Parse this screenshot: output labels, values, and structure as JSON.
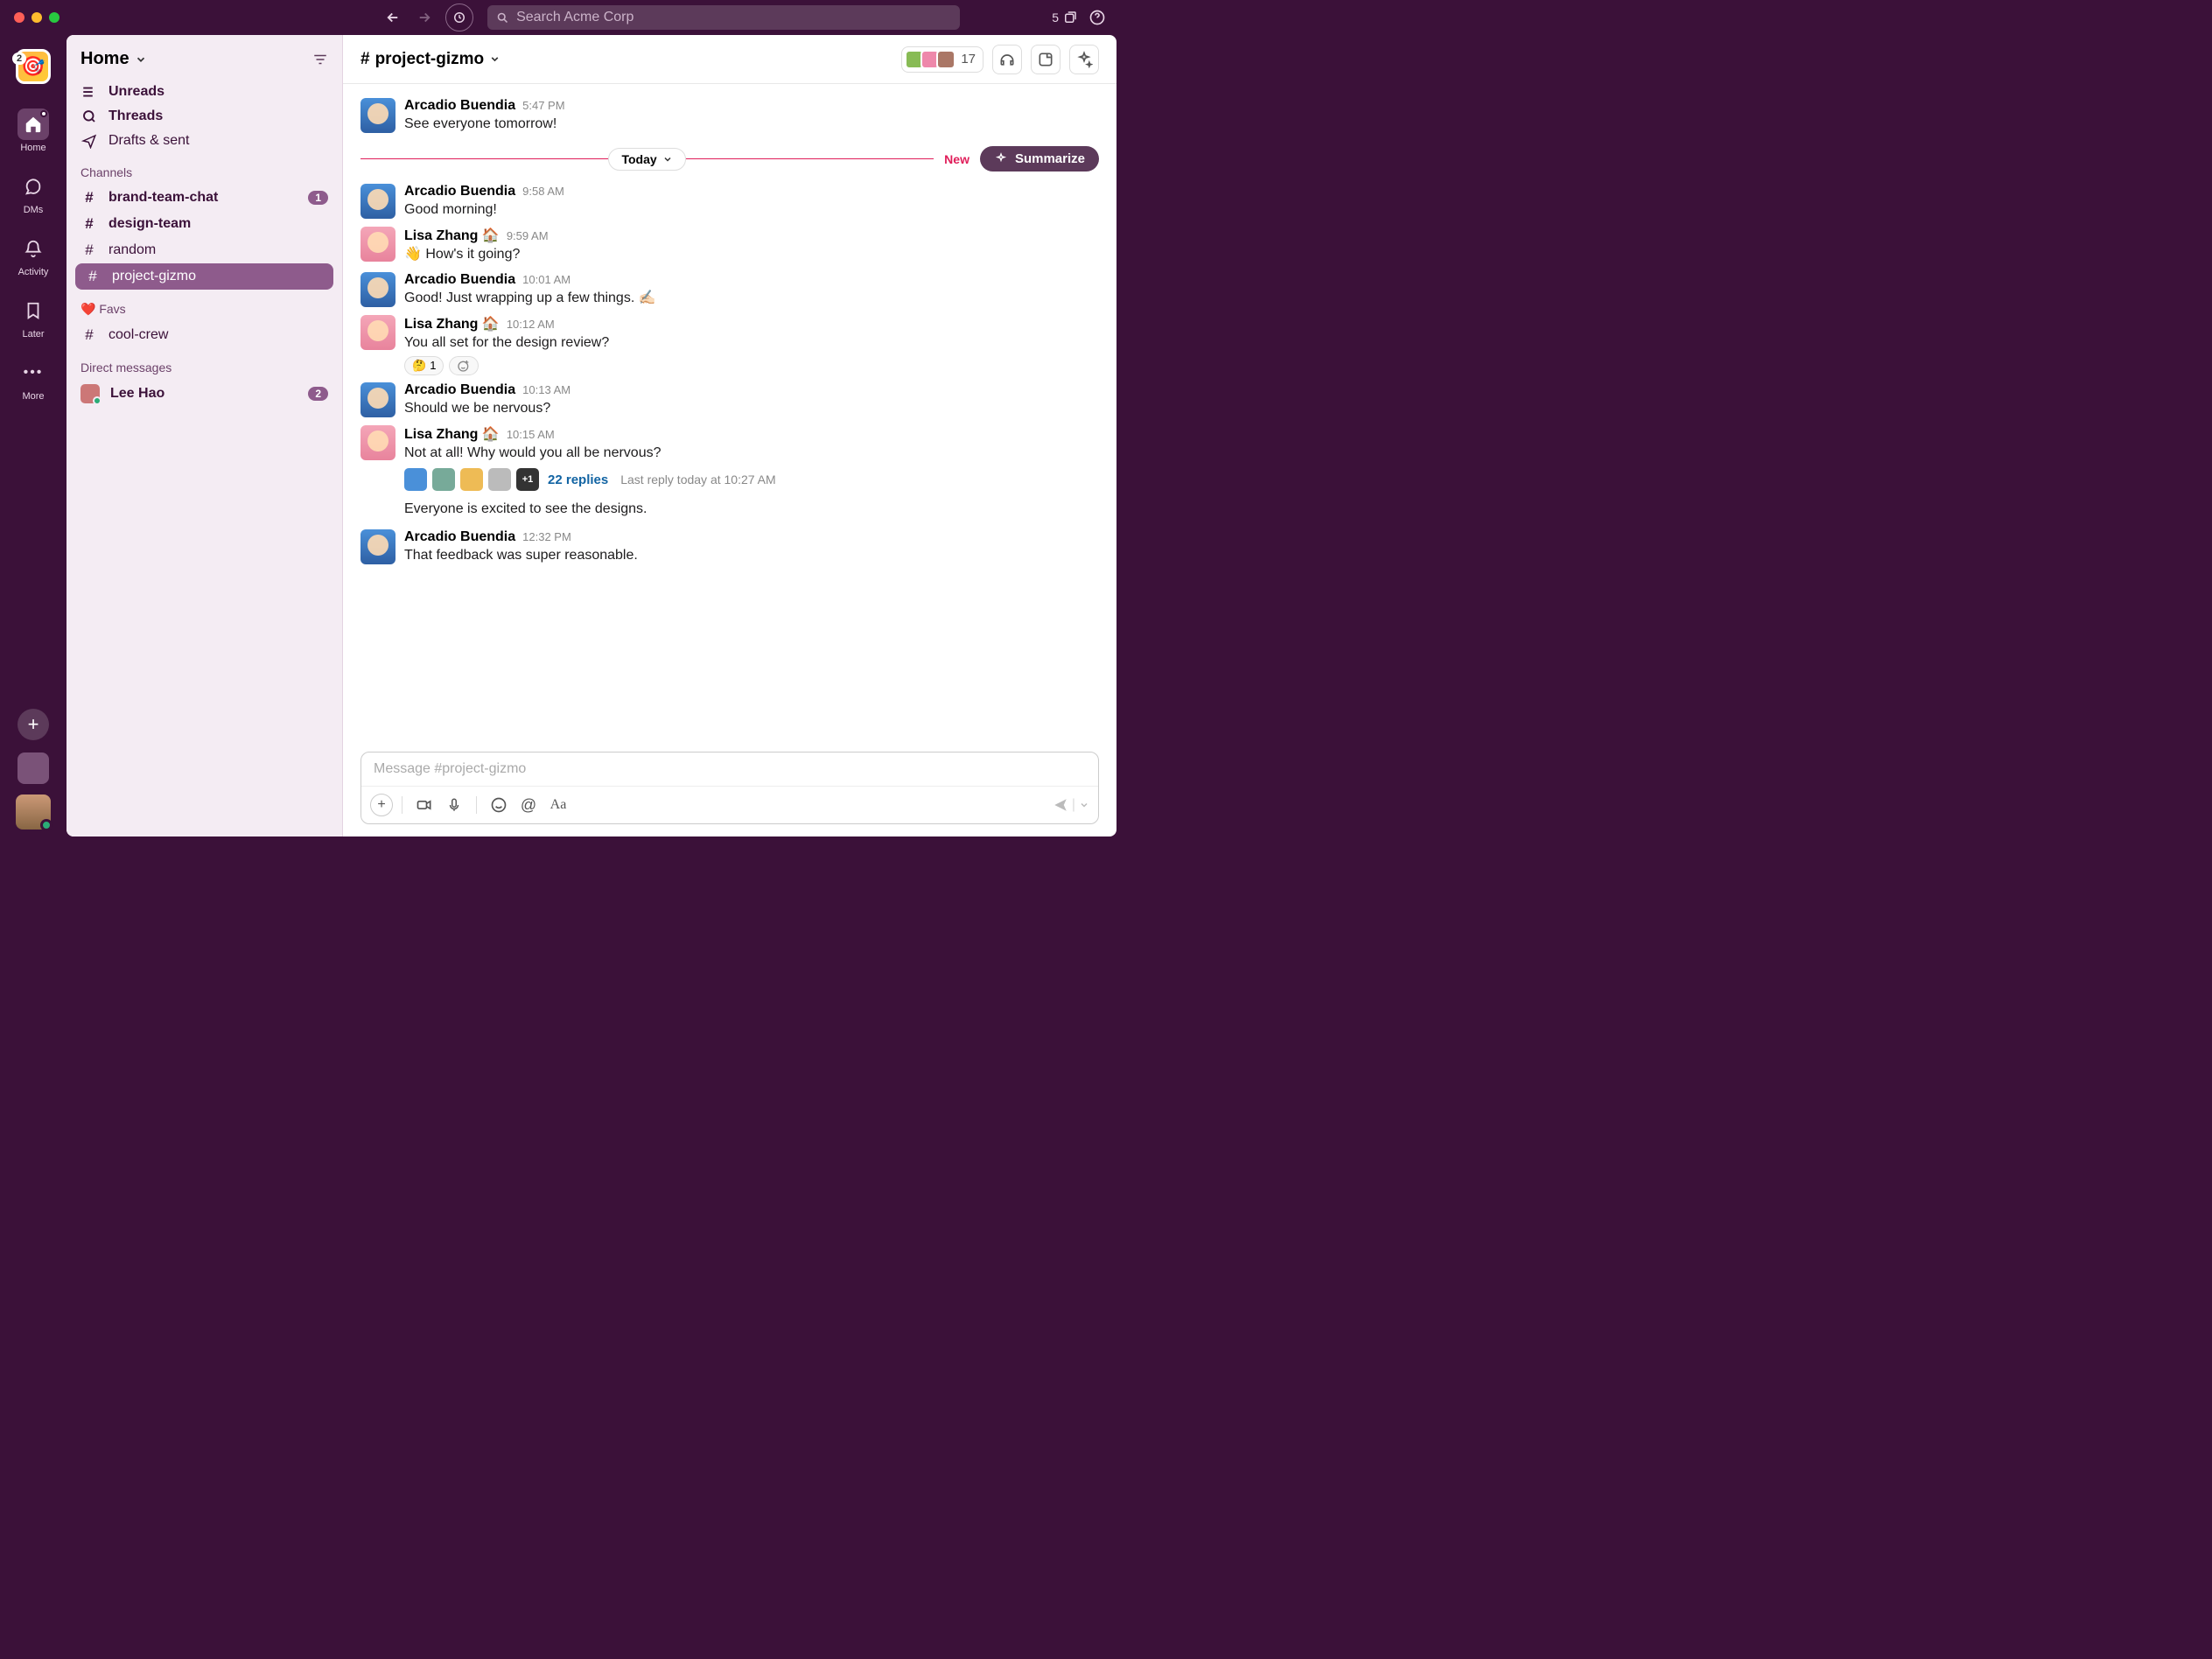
{
  "top": {
    "search_placeholder": "Search Acme Corp",
    "window_count": "5"
  },
  "workspace": {
    "badge": "2"
  },
  "rail": {
    "home": "Home",
    "dms": "DMs",
    "activity": "Activity",
    "later": "Later",
    "more": "More"
  },
  "sidebar": {
    "title": "Home",
    "unreads": "Unreads",
    "threads": "Threads",
    "drafts": "Drafts & sent",
    "channels_label": "Channels",
    "channels": [
      {
        "name": "brand-team-chat",
        "badge": "1",
        "bold": true
      },
      {
        "name": "design-team",
        "bold": true
      },
      {
        "name": "random"
      },
      {
        "name": "project-gizmo",
        "active": true
      }
    ],
    "favs_label": "Favs",
    "fav_channel": "cool-crew",
    "dms_label": "Direct messages",
    "dm_user": "Lee Hao",
    "dm_badge": "2"
  },
  "channel": {
    "name": "project-gizmo",
    "member_count": "17",
    "divider_label": "Today",
    "divider_new": "New",
    "summarize": "Summarize"
  },
  "messages": [
    {
      "user": "Arcadio Buendia",
      "time": "5:47 PM",
      "text": "See everyone tomorrow!",
      "avatar": "a"
    },
    {
      "user": "Arcadio Buendia",
      "time": "9:58 AM",
      "text": "Good morning!",
      "avatar": "a"
    },
    {
      "user": "Lisa Zhang 🏠",
      "time": "9:59 AM",
      "text": "👋 How's it going?",
      "avatar": "l"
    },
    {
      "user": "Arcadio Buendia",
      "time": "10:01 AM",
      "text": "Good! Just wrapping up a few things. ✍🏻",
      "avatar": "a"
    },
    {
      "user": "Lisa Zhang 🏠",
      "time": "10:12 AM",
      "text": "You all set for the design review?",
      "avatar": "l",
      "reactions": [
        {
          "emoji": "🤔",
          "count": "1"
        }
      ]
    },
    {
      "user": "Arcadio Buendia",
      "time": "10:13 AM",
      "text": "Should we be nervous?",
      "avatar": "a"
    },
    {
      "user": "Lisa Zhang 🏠",
      "time": "10:15 AM",
      "text": "Not at all! Why would you all be nervous?",
      "avatar": "l",
      "thread": {
        "replies": "22 replies",
        "last": "Last reply today at 10:27 AM",
        "extra": "+1"
      },
      "followup": "Everyone is excited to see the designs."
    },
    {
      "user": "Arcadio Buendia",
      "time": "12:32 PM",
      "text": "That feedback was super reasonable.",
      "avatar": "a"
    }
  ],
  "composer": {
    "placeholder": "Message #project-gizmo"
  }
}
